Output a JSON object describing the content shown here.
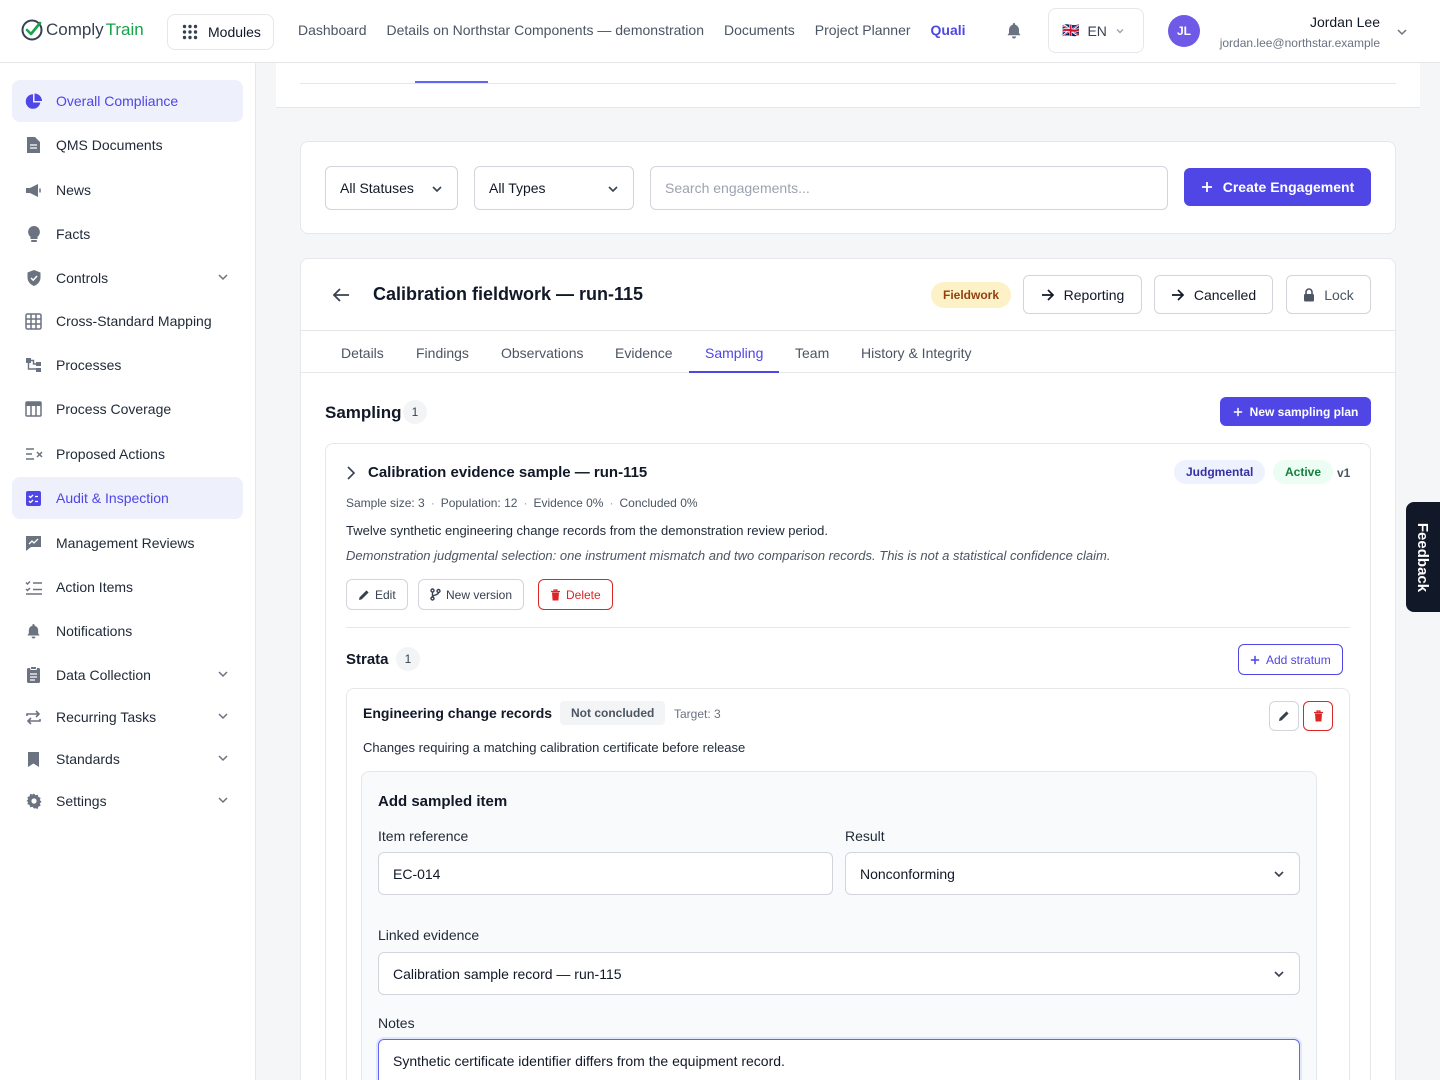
{
  "app": {
    "logo_part1": "Comply",
    "logo_part2": "Train",
    "modules_label": "Modules"
  },
  "topnav": [
    "Dashboard",
    "Details on Northstar Components — demonstration",
    "Documents",
    "Project Planner",
    "Quali"
  ],
  "language": {
    "code": "EN",
    "flag": "🇬🇧"
  },
  "user": {
    "initials": "JL",
    "name": "Jordan Lee",
    "email": "jordan.lee@northstar.example"
  },
  "sidebar": {
    "items": [
      {
        "label": "Overall Compliance",
        "icon": "pie-chart-icon",
        "active": true
      },
      {
        "label": "QMS Documents",
        "icon": "document-icon"
      },
      {
        "label": "News",
        "icon": "megaphone-icon"
      },
      {
        "label": "Facts",
        "icon": "lightbulb-icon"
      },
      {
        "label": "Controls",
        "icon": "shield-icon",
        "expandable": true
      },
      {
        "label": "Cross-Standard Mapping",
        "icon": "grid-icon"
      },
      {
        "label": "Processes",
        "icon": "flow-icon"
      },
      {
        "label": "Process Coverage",
        "icon": "table-icon"
      },
      {
        "label": "Proposed Actions",
        "icon": "list-x-icon"
      },
      {
        "label": "Audit & Inspection",
        "icon": "clipboard-check-icon",
        "active": true
      },
      {
        "label": "Management Reviews",
        "icon": "chart-board-icon"
      },
      {
        "label": "Action Items",
        "icon": "checklist-icon"
      },
      {
        "label": "Notifications",
        "icon": "bell-icon"
      },
      {
        "label": "Data Collection",
        "icon": "clipboard-icon",
        "expandable": true
      },
      {
        "label": "Recurring Tasks",
        "icon": "repeat-icon",
        "expandable": true
      },
      {
        "label": "Standards",
        "icon": "bookmark-icon",
        "expandable": true
      },
      {
        "label": "Settings",
        "icon": "gear-icon",
        "expandable": true
      }
    ]
  },
  "filters": {
    "status": "All Statuses",
    "type": "All Types",
    "search_placeholder": "Search engagements...",
    "create_label": "Create Engagement"
  },
  "engagement": {
    "title": "Calibration fieldwork — run-115",
    "status_badge": "Fieldwork",
    "actions": [
      "Reporting",
      "Cancelled",
      "Lock"
    ],
    "tabs": [
      "Details",
      "Findings",
      "Observations",
      "Evidence",
      "Sampling",
      "Team",
      "History & Integrity"
    ],
    "active_tab": "Sampling"
  },
  "sampling": {
    "title": "Sampling",
    "count": "1",
    "new_plan_label": "New sampling plan",
    "plan": {
      "title": "Calibration evidence sample — run-115",
      "method": "Judgmental",
      "status": "Active",
      "version": "v1",
      "meta": [
        "Sample size: 3",
        "Population: 12",
        "Evidence 0%",
        "Concluded 0%"
      ],
      "description": "Twelve synthetic engineering change records from the demonstration review period.",
      "rationale": "Demonstration judgmental selection: one instrument mismatch and two comparison records. This is not a statistical confidence claim.",
      "buttons": {
        "edit": "Edit",
        "new_version": "New version",
        "delete": "Delete"
      }
    },
    "strata": {
      "title": "Strata",
      "count": "1",
      "add_label": "Add stratum",
      "item": {
        "name": "Engineering change records",
        "status": "Not concluded",
        "target": "Target: 3",
        "description": "Changes requiring a matching calibration certificate before release"
      }
    },
    "form": {
      "title": "Add sampled item",
      "item_ref_label": "Item reference",
      "item_ref_value": "EC-014",
      "result_label": "Result",
      "result_value": "Nonconforming",
      "evidence_label": "Linked evidence",
      "evidence_value": "Calibration sample record — run-115",
      "notes_label": "Notes",
      "notes_value": "Synthetic certificate identifier differs from the equipment record."
    }
  },
  "feedback_label": "Feedback",
  "colors": {
    "accent": "#4f46e5",
    "success": "#16a34a",
    "danger": "#dc2626",
    "warning_bg": "#fdf1c7"
  }
}
